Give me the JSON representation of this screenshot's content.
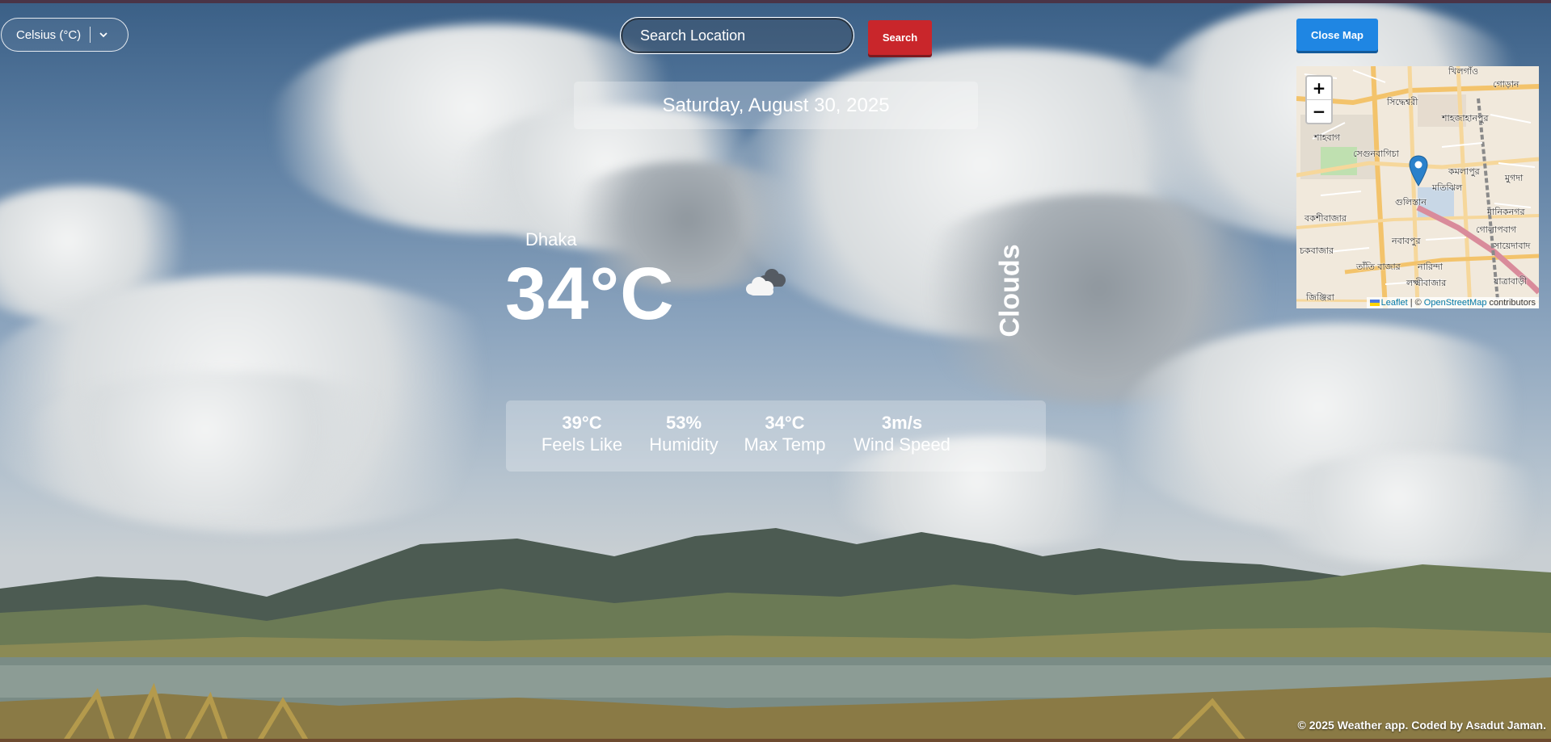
{
  "unit_select": {
    "value": "Celsius (°C)"
  },
  "search": {
    "placeholder": "Search Location",
    "button_label": "Search"
  },
  "date": "Saturday, August 30, 2025",
  "weather": {
    "city": "Dhaka",
    "temperature": "34°C",
    "condition": "Clouds",
    "condition_icon": "clouds-icon"
  },
  "stats": [
    {
      "value": "39°C",
      "label": "Feels Like"
    },
    {
      "value": "53%",
      "label": "Humidity"
    },
    {
      "value": "34°C",
      "label": "Max Temp"
    },
    {
      "value": "3m/s",
      "label": "Wind Speed"
    }
  ],
  "map": {
    "close_label": "Close Map",
    "zoom_in": "+",
    "zoom_out": "−",
    "labels": [
      "খিলগাঁও",
      "গোড়ান",
      "সিদ্ধেশ্বরী",
      "শাহজাহানপুর",
      "শাহবাগ",
      "সেগুনবাগিচা",
      "কমলাপুর",
      "মুগদা",
      "মতিঝিল",
      "গুলিস্তান",
      "বকশীবাজার",
      "মানিকনগর",
      "গোলাপবাগ",
      "নবাবপুর",
      "সায়েদাবাদ",
      "চকবাজার",
      "তাঁতি বাজার",
      "নারিন্দা",
      "লক্ষ্মীবাজার",
      "যাত্রাবাড়ী",
      "জিঞ্জিরা"
    ],
    "attribution": {
      "leaflet": "Leaflet",
      "separator": "| ©",
      "osm": "OpenStreetMap",
      "suffix": "contributors"
    }
  },
  "footer": "© 2025 Weather app. Coded by Asadut Jaman."
}
